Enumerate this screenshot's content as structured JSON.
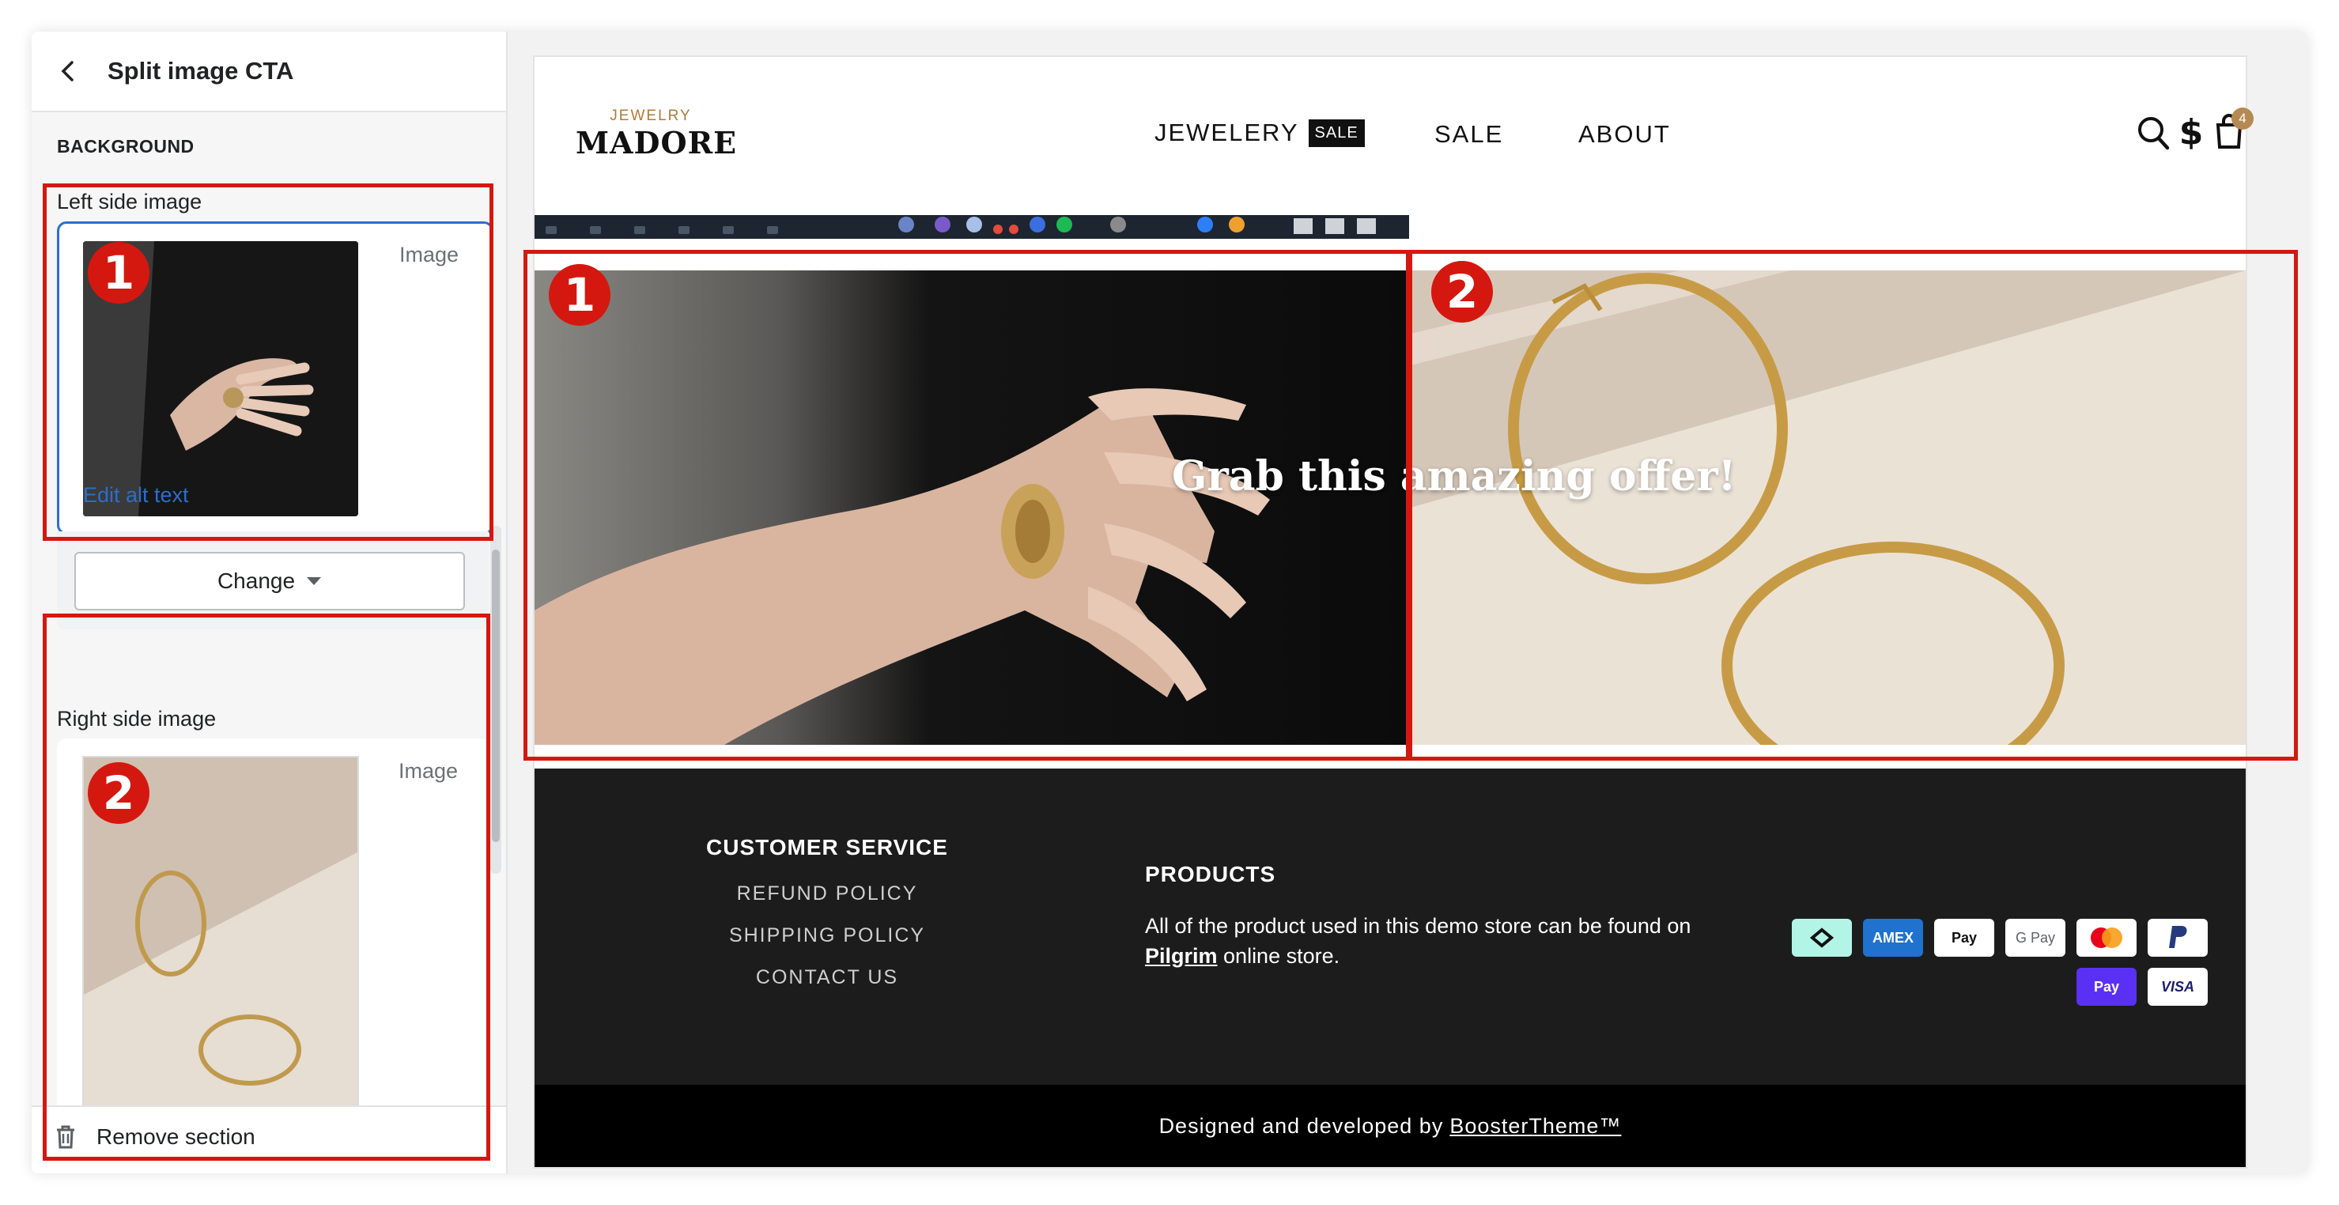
{
  "panel": {
    "title": "Split image CTA",
    "section_heading": "BACKGROUND",
    "left_image": {
      "label": "Left side image",
      "tag": "Image",
      "edit_alt": "Edit alt text"
    },
    "change_button": "Change",
    "right_image": {
      "label": "Right side image",
      "tag": "Image"
    },
    "remove_section": "Remove section"
  },
  "annotations": [
    "1",
    "2"
  ],
  "store": {
    "logo_top": "JEWELRY",
    "logo_main": "MADORE",
    "nav": [
      {
        "label": "JEWELERY",
        "badge": "SALE"
      },
      {
        "label": "SALE"
      },
      {
        "label": "ABOUT"
      }
    ],
    "cart_count": "4",
    "cta_text": "Grab this amazing offer!",
    "footer": {
      "customer_service": {
        "heading": "CUSTOMER SERVICE",
        "links": [
          "REFUND POLICY",
          "SHIPPING POLICY",
          "CONTACT US"
        ]
      },
      "products": {
        "heading": "PRODUCTS",
        "text_before": "All of the product used in this demo store can be found on",
        "link": " Pilgrim",
        "text_after": " online store."
      },
      "payments": [
        "AMEX",
        "Pay",
        "G Pay",
        "PayPal",
        "Pay",
        "VISA"
      ],
      "credits_prefix": "Designed and developed by ",
      "credits_link": "BoosterTheme™"
    }
  },
  "colors": {
    "annotation_red": "#d4180f",
    "focus_blue": "#2c6ecb",
    "footer_bg": "#1c1c1c",
    "logo_gold": "#b07a3a"
  },
  "icons": [
    "back-chevron-icon",
    "caret-down-icon",
    "trash-icon",
    "search-icon",
    "currency-icon",
    "cart-icon"
  ]
}
